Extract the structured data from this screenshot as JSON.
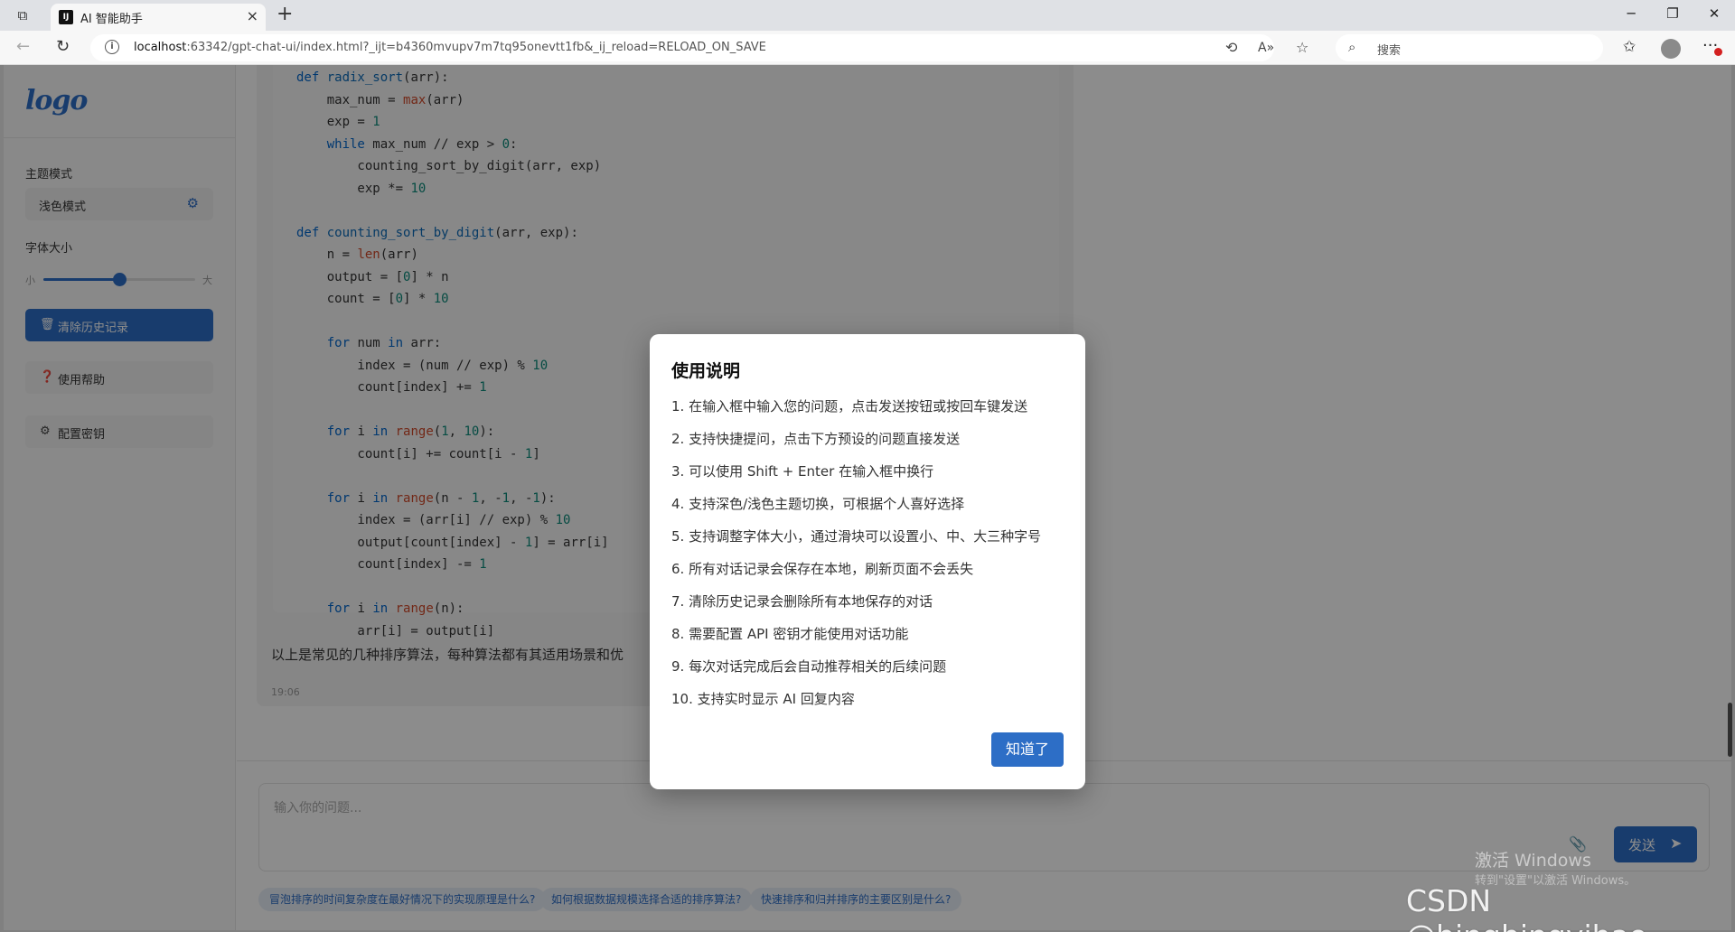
{
  "browser": {
    "tab_title": "AI 智能助手",
    "tab_favicon": "IJ",
    "url_host": "localhost",
    "url_rest": ":63342/gpt-chat-ui/index.html?_ijt=b4360mvupv7m7tq95onevtt1fb&_ij_reload=RELOAD_ON_SAVE",
    "search_placeholder": "搜索"
  },
  "sidebar": {
    "logo": "logo",
    "theme_label": "主题模式",
    "theme_value": "浅色模式",
    "font_label": "字体大小",
    "font_small": "小",
    "font_large": "大",
    "font_slider_fraction": 0.5,
    "clear_history": "清除历史记录",
    "help": "使用帮助",
    "api_key": "配置密钥"
  },
  "chat": {
    "code_lines": [
      [
        {
          "t": "def ",
          "c": "kw"
        },
        {
          "t": "radix_sort",
          "c": "fn"
        },
        {
          "t": "(arr):",
          "c": ""
        }
      ],
      [
        {
          "t": "    max_num = ",
          "c": ""
        },
        {
          "t": "max",
          "c": "bi"
        },
        {
          "t": "(arr)",
          "c": ""
        }
      ],
      [
        {
          "t": "    exp = ",
          "c": ""
        },
        {
          "t": "1",
          "c": "nm"
        }
      ],
      [
        {
          "t": "    ",
          "c": ""
        },
        {
          "t": "while",
          "c": "kw"
        },
        {
          "t": " max_num // exp > ",
          "c": ""
        },
        {
          "t": "0",
          "c": "nm"
        },
        {
          "t": ":",
          "c": ""
        }
      ],
      [
        {
          "t": "        counting_sort_by_digit(arr, exp)",
          "c": ""
        }
      ],
      [
        {
          "t": "        exp *= ",
          "c": ""
        },
        {
          "t": "10",
          "c": "nm"
        }
      ],
      [],
      [
        {
          "t": "def ",
          "c": "kw"
        },
        {
          "t": "counting_sort_by_digit",
          "c": "fn"
        },
        {
          "t": "(arr, exp):",
          "c": ""
        }
      ],
      [
        {
          "t": "    n = ",
          "c": ""
        },
        {
          "t": "len",
          "c": "bi"
        },
        {
          "t": "(arr)",
          "c": ""
        }
      ],
      [
        {
          "t": "    output = [",
          "c": ""
        },
        {
          "t": "0",
          "c": "nm"
        },
        {
          "t": "] * n",
          "c": ""
        }
      ],
      [
        {
          "t": "    count = [",
          "c": ""
        },
        {
          "t": "0",
          "c": "nm"
        },
        {
          "t": "] * ",
          "c": ""
        },
        {
          "t": "10",
          "c": "nm"
        }
      ],
      [],
      [
        {
          "t": "    ",
          "c": ""
        },
        {
          "t": "for",
          "c": "kw"
        },
        {
          "t": " num ",
          "c": ""
        },
        {
          "t": "in",
          "c": "kw"
        },
        {
          "t": " arr:",
          "c": ""
        }
      ],
      [
        {
          "t": "        index = (num // exp) % ",
          "c": ""
        },
        {
          "t": "10",
          "c": "nm"
        }
      ],
      [
        {
          "t": "        count[index] += ",
          "c": ""
        },
        {
          "t": "1",
          "c": "nm"
        }
      ],
      [],
      [
        {
          "t": "    ",
          "c": ""
        },
        {
          "t": "for",
          "c": "kw"
        },
        {
          "t": " i ",
          "c": ""
        },
        {
          "t": "in",
          "c": "kw"
        },
        {
          "t": " ",
          "c": ""
        },
        {
          "t": "range",
          "c": "bi"
        },
        {
          "t": "(",
          "c": ""
        },
        {
          "t": "1",
          "c": "nm"
        },
        {
          "t": ", ",
          "c": ""
        },
        {
          "t": "10",
          "c": "nm"
        },
        {
          "t": "):",
          "c": ""
        }
      ],
      [
        {
          "t": "        count[i] += count[i - ",
          "c": ""
        },
        {
          "t": "1",
          "c": "nm"
        },
        {
          "t": "]",
          "c": ""
        }
      ],
      [],
      [
        {
          "t": "    ",
          "c": ""
        },
        {
          "t": "for",
          "c": "kw"
        },
        {
          "t": " i ",
          "c": ""
        },
        {
          "t": "in",
          "c": "kw"
        },
        {
          "t": " ",
          "c": ""
        },
        {
          "t": "range",
          "c": "bi"
        },
        {
          "t": "(n - ",
          "c": ""
        },
        {
          "t": "1",
          "c": "nm"
        },
        {
          "t": ", -",
          "c": ""
        },
        {
          "t": "1",
          "c": "nm"
        },
        {
          "t": ", -",
          "c": ""
        },
        {
          "t": "1",
          "c": "nm"
        },
        {
          "t": "):",
          "c": ""
        }
      ],
      [
        {
          "t": "        index = (arr[i] // exp) % ",
          "c": ""
        },
        {
          "t": "10",
          "c": "nm"
        }
      ],
      [
        {
          "t": "        output[count[index] - ",
          "c": ""
        },
        {
          "t": "1",
          "c": "nm"
        },
        {
          "t": "] = arr[i]",
          "c": ""
        }
      ],
      [
        {
          "t": "        count[index] -= ",
          "c": ""
        },
        {
          "t": "1",
          "c": "nm"
        }
      ],
      [],
      [
        {
          "t": "    ",
          "c": ""
        },
        {
          "t": "for",
          "c": "kw"
        },
        {
          "t": " i ",
          "c": ""
        },
        {
          "t": "in",
          "c": "kw"
        },
        {
          "t": " ",
          "c": ""
        },
        {
          "t": "range",
          "c": "bi"
        },
        {
          "t": "(n):",
          "c": ""
        }
      ],
      [
        {
          "t": "        arr[i] = output[i]",
          "c": ""
        }
      ]
    ],
    "message_text": "以上是常见的几种排序算法，每种算法都有其适用场景和优",
    "message_time": "19:06"
  },
  "input": {
    "placeholder": "输入你的问题...",
    "send_label": "发送",
    "suggestions": [
      "冒泡排序的时间复杂度在最好情况下的实现原理是什么?",
      "如何根据数据规模选择合适的排序算法?",
      "快速排序和归并排序的主要区别是什么?"
    ]
  },
  "modal": {
    "title": "使用说明",
    "items": [
      "1. 在输入框中输入您的问题，点击发送按钮或按回车键发送",
      "2. 支持快捷提问，点击下方预设的问题直接发送",
      "3. 可以使用 Shift + Enter 在输入框中换行",
      "4. 支持深色/浅色主题切换，可根据个人喜好选择",
      "5. 支持调整字体大小，通过滑块可以设置小、中、大三种字号",
      "6. 所有对话记录会保存在本地，刷新页面不会丢失",
      "7. 清除历史记录会删除所有本地保存的对话",
      "8. 需要配置 API 密钥才能使用对话功能",
      "9. 每次对话完成后会自动推荐相关的后续问题",
      "10. 支持实时显示 AI 回复内容"
    ],
    "ok_label": "知道了"
  },
  "watermarks": {
    "windows_line1": "激活 Windows",
    "windows_line2": "转到\"设置\"以激活 Windows。",
    "csdn": "CSDN @bingbingyihao"
  },
  "colors": {
    "accent": "#2d6ec6"
  }
}
